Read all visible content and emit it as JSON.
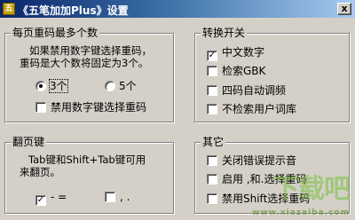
{
  "window": {
    "title": "《五笔加加Plus》设置",
    "close_glyph": "x"
  },
  "group_dup_code": {
    "title": "每页重码最多个数",
    "note_line1": "如果禁用数字键选择重码，",
    "note_line2": "重码是大个数将固定为3个。",
    "option_3": "3个",
    "option_5": "5个",
    "selected": "3个",
    "disable_digit_label": "禁用数字键选择重码",
    "disable_digit_checked": false
  },
  "group_switch": {
    "title": "转换开关",
    "items": [
      {
        "label": "中文数字",
        "checked": true
      },
      {
        "label": "检索GBK",
        "checked": false
      },
      {
        "label": "四码自动调频",
        "checked": false
      },
      {
        "label": "不检索用户词库",
        "checked": false
      }
    ]
  },
  "group_page": {
    "title": "翻页键",
    "note_line1": "Tab键和Shift+Tab键可用",
    "note_line2": "来翻页。",
    "option_minus_equal": "- =",
    "option_comma_period": ", .",
    "minus_equal_checked": true,
    "comma_period_checked": false
  },
  "group_other": {
    "title": "其它",
    "items": [
      {
        "label": "关闭错误提示音",
        "checked": false
      },
      {
        "label": "启用 ,和.选择重码",
        "checked": false
      },
      {
        "label": "禁用Shift选择重码",
        "checked": false
      }
    ]
  },
  "watermark": {
    "text": "下载吧",
    "sub": "www.xiazaiba.com"
  },
  "icons": {
    "check": "✓"
  }
}
